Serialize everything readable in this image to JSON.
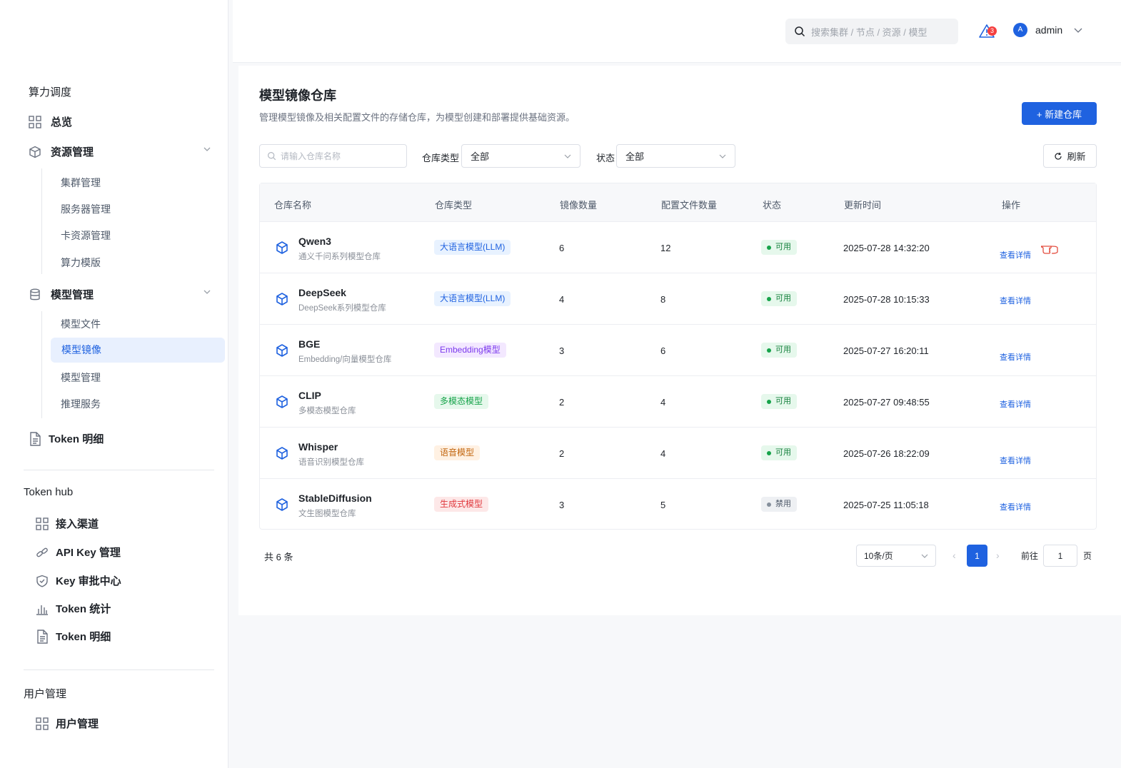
{
  "sidebar": {
    "section1": "算力调度",
    "overview": "总览",
    "resource": "资源管理",
    "resource_items": [
      "集群管理",
      "服务器管理",
      "卡资源管理",
      "算力模版"
    ],
    "model": "模型管理",
    "model_items": [
      "模型文件",
      "模型镜像",
      "模型管理",
      "推理服务"
    ],
    "token_detail": "Token 明细",
    "section2": "Token hub",
    "hub_items": [
      "接入渠道",
      "API Key 管理",
      "Key 审批中心",
      "Token 统计",
      "Token 明细"
    ],
    "section3": "用户管理",
    "user_item": "用户管理"
  },
  "header": {
    "search_placeholder": "搜索集群 / 节点 / 资源 / 模型",
    "notification_count": "3",
    "avatar_letter": "A",
    "username": "admin"
  },
  "page": {
    "title": "模型镜像仓库",
    "description": "管理模型镜像及相关配置文件的存储仓库，为模型创建和部署提供基础资源。",
    "new_button": "+ 新建仓库"
  },
  "filters": {
    "search_placeholder": "请输入仓库名称",
    "type_label": "仓库类型",
    "type_value": "全部",
    "status_label": "状态",
    "status_value": "全部",
    "refresh": "刷新"
  },
  "table": {
    "headers": [
      "仓库名称",
      "仓库类型",
      "镜像数量",
      "配置文件数量",
      "状态",
      "更新时间",
      "操作"
    ],
    "rows": [
      {
        "name": "Qwen3",
        "desc": "通义千问系列模型仓库",
        "type": "大语言模型(LLM)",
        "images": "6",
        "configs": "12",
        "status": "可用",
        "updated": "2025-07-28 14:32:20",
        "action": "查看详情"
      },
      {
        "name": "DeepSeek",
        "desc": "DeepSeek系列模型仓库",
        "type": "大语言模型(LLM)",
        "images": "4",
        "configs": "8",
        "status": "可用",
        "updated": "2025-07-28 10:15:33",
        "action": "查看详情"
      },
      {
        "name": "BGE",
        "desc": "Embedding/向量模型仓库",
        "type": "Embedding模型",
        "images": "3",
        "configs": "6",
        "status": "可用",
        "updated": "2025-07-27 16:20:11",
        "action": "查看详情"
      },
      {
        "name": "CLIP",
        "desc": "多模态模型仓库",
        "type": "多模态模型",
        "images": "2",
        "configs": "4",
        "status": "可用",
        "updated": "2025-07-27 09:48:55",
        "action": "查看详情"
      },
      {
        "name": "Whisper",
        "desc": "语音识别模型仓库",
        "type": "语音模型",
        "images": "2",
        "configs": "4",
        "status": "可用",
        "updated": "2025-07-26 18:22:09",
        "action": "查看详情"
      },
      {
        "name": "StableDiffusion",
        "desc": "文生图模型仓库",
        "type": "生成式模型",
        "images": "3",
        "configs": "5",
        "status": "禁用",
        "updated": "2025-07-25 11:05:18",
        "action": "查看详情"
      }
    ]
  },
  "pagination": {
    "total": "共 6 条",
    "page_size": "10条/页",
    "current": "1",
    "goto_label": "前往",
    "goto_value": "1",
    "goto_unit": "页"
  },
  "colors": {
    "primary": "#1f62e0",
    "success": "#00b42a",
    "danger": "#f53f3f"
  }
}
